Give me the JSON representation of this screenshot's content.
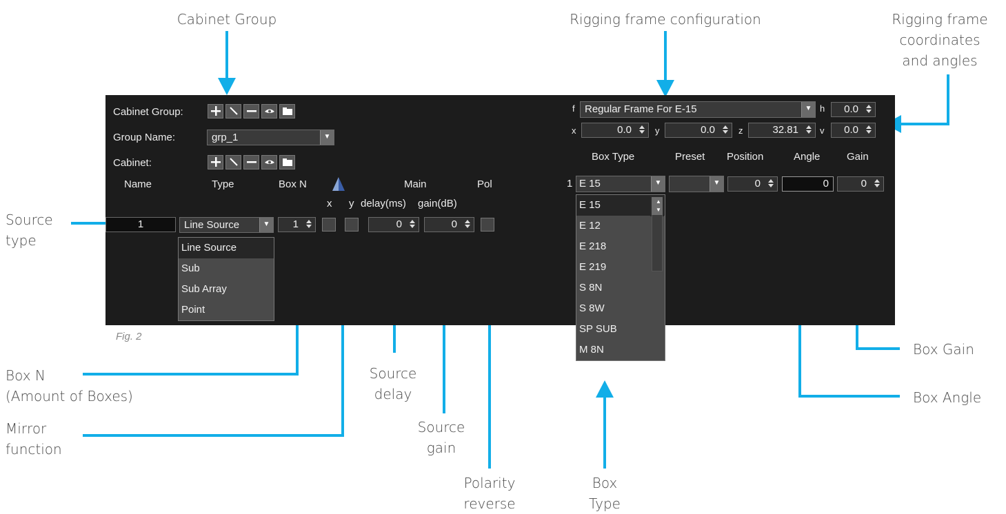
{
  "annotations": {
    "cabinet_group": "Cabinet Group",
    "rigging_frame_config": "Rigging frame configuration",
    "rigging_coords_l1": "Rigging frame",
    "rigging_coords_l2": "coordinates",
    "rigging_coords_l3": "and angles",
    "source_type_l1": "Source",
    "source_type_l2": "type",
    "box_n_l1": "Box N",
    "box_n_l2": "(Amount of Boxes)",
    "mirror_l1": "Mirror",
    "mirror_l2": "function",
    "source_delay_l1": "Source",
    "source_delay_l2": "delay",
    "source_gain_l1": "Source",
    "source_gain_l2": "gain",
    "polarity_l1": "Polarity",
    "polarity_l2": "reverse",
    "box_type_l1": "Box",
    "box_type_l2": "Type",
    "box_gain": "Box Gain",
    "box_angle": "Box Angle"
  },
  "panel": {
    "cabinet_group_label": "Cabinet Group:",
    "group_name_label": "Group Name:",
    "group_name_value": "grp_1",
    "cabinet_label": "Cabinet:",
    "headers": {
      "name": "Name",
      "type": "Type",
      "box_n": "Box N",
      "main": "Main",
      "pol": "Pol",
      "x": "x",
      "y": "y",
      "delay": "delay(ms)",
      "gain": "gain(dB)"
    },
    "row": {
      "name": "1",
      "type": "Line Source",
      "box_n": "1",
      "delay": "0",
      "gain": "0"
    },
    "type_options": [
      "Line Source",
      "Sub",
      "Sub Array",
      "Point"
    ],
    "figure_label": "Fig. 2"
  },
  "rigging": {
    "f_label": "f",
    "frame_value": "Regular Frame For E-15",
    "h_label": "h",
    "h_value": "0.0",
    "x_label": "x",
    "x_value": "0.0",
    "y_label": "y",
    "y_value": "0.0",
    "z_label": "z",
    "z_value": "32.81",
    "v_label": "v",
    "v_value": "0.0",
    "headers": {
      "box_type": "Box Type",
      "preset": "Preset",
      "position": "Position",
      "angle": "Angle",
      "gain": "Gain"
    },
    "row": {
      "index": "1",
      "box_type": "E 15",
      "position": "0",
      "angle": "0",
      "gain": "0"
    },
    "box_type_options": [
      "E 15",
      "E 12",
      "E 218",
      "E 219",
      "S 8N",
      "S 8W",
      "SP SUB",
      "M 8N"
    ]
  },
  "colors": {
    "accent_arrow": "#12aee8",
    "panel_bg": "#1c1c1c"
  }
}
